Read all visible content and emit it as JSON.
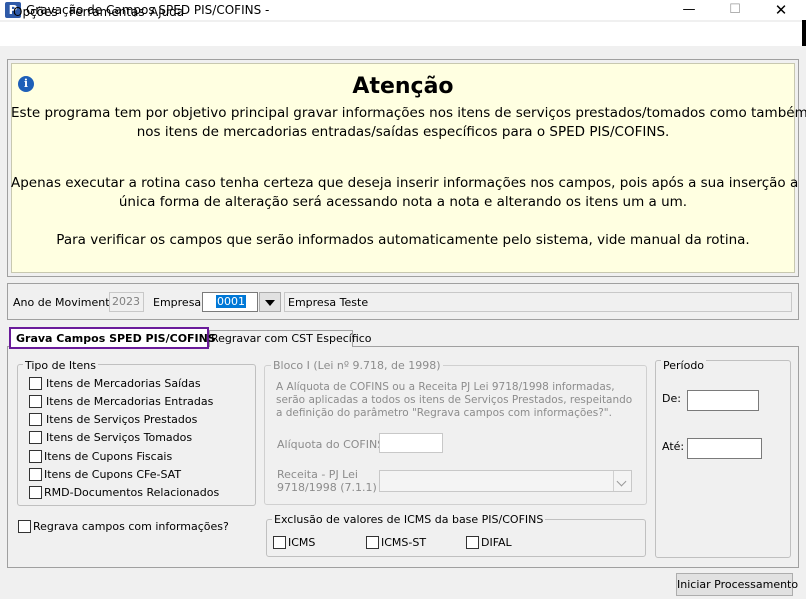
{
  "window": {
    "title": "Gravação de Campos SPED PIS/COFINS -",
    "app_icon_letter": "P",
    "minimize": "—",
    "maximize": "☐",
    "close": "✕"
  },
  "menu": {
    "items": [
      "Opções",
      "Ferramentas",
      "Ajuda"
    ]
  },
  "warning": {
    "title": "Atenção",
    "icon": "info-icon",
    "lines": [
      "Este programa tem por objetivo principal gravar informações nos itens de serviços prestados/tomados como também",
      "nos itens de mercadorias entradas/saídas específicos para o SPED PIS/COFINS.",
      "Apenas executar a rotina caso tenha certeza que deseja inserir informações nos campos, pois após a sua inserção a",
      "única forma de alteração será acessando nota a nota e alterando os itens um a um.",
      "Para verificar os campos que serão informados automaticamente pelo sistema, vide manual da rotina."
    ],
    "background": "#ffffe1"
  },
  "movement": {
    "ano_label": "Ano de Movimento:",
    "ano_value": "2023",
    "empresa_label": "Empresa:",
    "empresa_code": "0001",
    "empresa_name": "Empresa Teste"
  },
  "tabs": [
    {
      "label": "Grava Campos SPED PIS/COFINS",
      "active": true
    },
    {
      "label": "Regravar com CST Específico",
      "active": false
    }
  ],
  "tipo_itens": {
    "legend": "Tipo de Itens",
    "items": [
      {
        "label": "Itens de Mercadorias Saídas",
        "checked": false
      },
      {
        "label": "Itens de Mercadorias Entradas",
        "checked": false
      },
      {
        "label": "Itens de Serviços Prestados",
        "checked": false
      },
      {
        "label": "Itens de Serviços Tomados",
        "checked": false
      },
      {
        "label": "Itens de Cupons Fiscais",
        "checked": false
      },
      {
        "label": "Itens de Cupons CFe-SAT",
        "checked": false
      },
      {
        "label": "RMD-Documentos Relacionados",
        "checked": false
      }
    ]
  },
  "regrava": {
    "label": "Regrava campos com informações?",
    "checked": false
  },
  "bloco": {
    "legend": "Bloco I (Lei nº 9.718, de 1998)",
    "description": "A Alíquota de COFINS ou a Receita PJ Lei 9718/1998 informadas, serão aplicadas a todos os itens de Serviços Prestados, respeitando a definição do parâmetro \"Regrava campos com informações?\".",
    "aliquota_label": "Alíquota do COFINS",
    "aliquota_value": "",
    "receita_label_line1": "Receita - PJ Lei",
    "receita_label_line2": "9718/1998 (7.1.1)",
    "receita_value": ""
  },
  "exclusao": {
    "legend": "Exclusão de valores de ICMS da base PIS/COFINS",
    "items": [
      {
        "label": "ICMS",
        "checked": false
      },
      {
        "label": "ICMS-ST",
        "checked": false
      },
      {
        "label": "DIFAL",
        "checked": false
      }
    ]
  },
  "periodo": {
    "legend": "Período",
    "de_label": "De:",
    "de_value": "",
    "ate_label": "Até:",
    "ate_value": ""
  },
  "actions": {
    "iniciar_label": "Iniciar Processamento"
  },
  "colors": {
    "active_tab_border": "#6a1b9a",
    "selection": "#0078d7"
  }
}
